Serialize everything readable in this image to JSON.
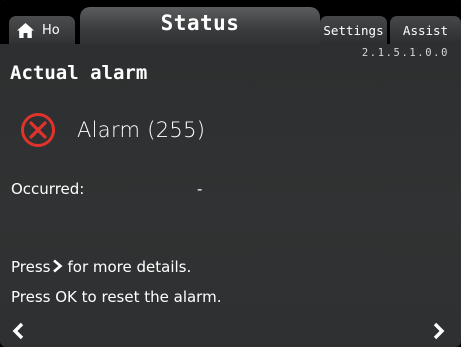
{
  "tabs": {
    "home_label": "Ho",
    "status_label": "Status",
    "settings_label": "Settings",
    "assist_label": "Assist"
  },
  "menu_id": "2.1.5.1.0.0",
  "page": {
    "title": "Actual alarm",
    "alarm_text": "Alarm (255)",
    "occurred_label": "Occurred:",
    "occurred_value": "-"
  },
  "hints": {
    "details_prefix": "Press",
    "details_suffix": "for more details.",
    "reset": "Press OK to reset the alarm."
  },
  "icons": {
    "home": "house-icon",
    "alarm": "alarm-x-circle-icon",
    "next_inline": "chevron-right-icon",
    "back": "chevron-left-icon",
    "forward": "chevron-right-icon"
  },
  "colors": {
    "background": "#2e3031",
    "alarm_red": "#e0332b",
    "text": "#ffffff"
  }
}
